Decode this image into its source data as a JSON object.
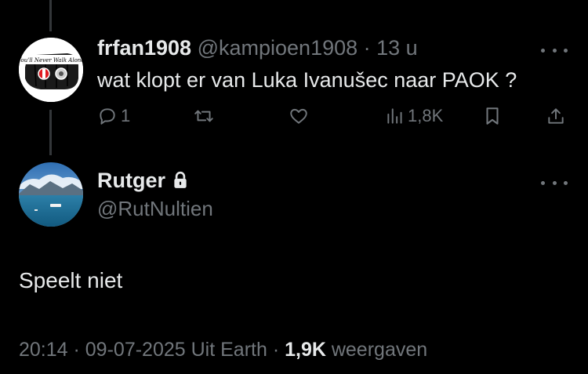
{
  "reply": {
    "display_name": "frfan1908",
    "handle": "@kampioen1908",
    "separator": " · ",
    "time": "13 u",
    "text": "wat klopt er van Luka Ivanušec naar PAOK ?",
    "avatar_text": "You'll Never Walk Alone",
    "actions": {
      "replies": "1",
      "views": "1,8K"
    }
  },
  "main": {
    "display_name": "Rutger",
    "handle": "@RutNultien",
    "text": "Speelt niet",
    "meta": {
      "time": "20:14",
      "sep1": " · ",
      "date": "09-07-2025",
      "location": " Uit Earth",
      "sep2": " · ",
      "views": "1,9K",
      "views_label": " weergaven"
    }
  },
  "icons": {
    "more": "more-icon",
    "reply": "reply-icon",
    "retweet": "retweet-icon",
    "like": "heart-icon",
    "views": "views-icon",
    "bookmark": "bookmark-icon",
    "share": "share-icon",
    "lock": "lock-icon"
  },
  "colors": {
    "background": "#000000",
    "text": "#e7e9ea",
    "muted": "#71767b",
    "thread_line": "#333639"
  }
}
